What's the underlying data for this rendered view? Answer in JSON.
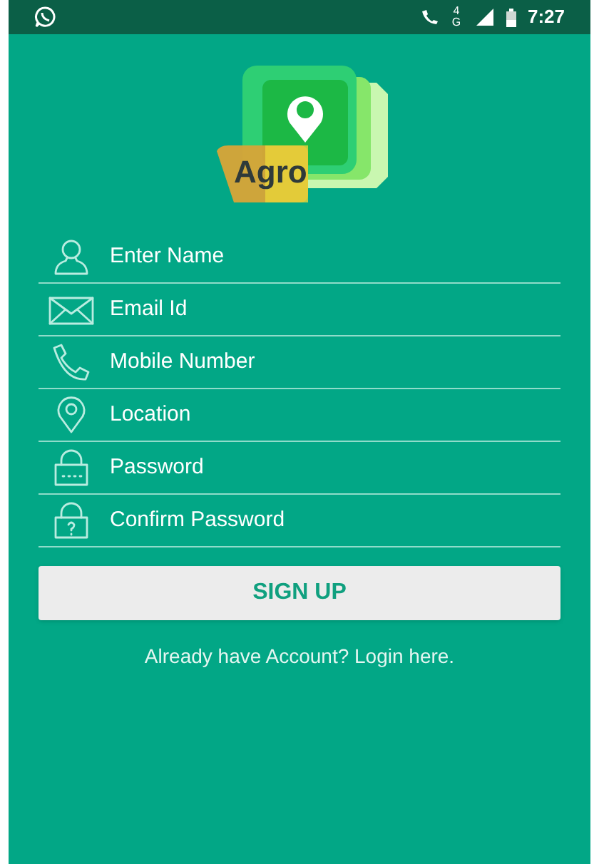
{
  "status_bar": {
    "time": "7:27",
    "network": "4G"
  },
  "logo": {
    "label": "Agro"
  },
  "fields": [
    {
      "kind": "person",
      "placeholder": "Enter Name"
    },
    {
      "kind": "mail",
      "placeholder": "Email Id"
    },
    {
      "kind": "phone",
      "placeholder": "Mobile Number"
    },
    {
      "kind": "pin",
      "placeholder": "Location"
    },
    {
      "kind": "lock",
      "placeholder": "Password"
    },
    {
      "kind": "lock-question",
      "placeholder": "Confirm Password"
    }
  ],
  "signup_button": "SIGN UP",
  "login_link": "Already have Account? Login here."
}
